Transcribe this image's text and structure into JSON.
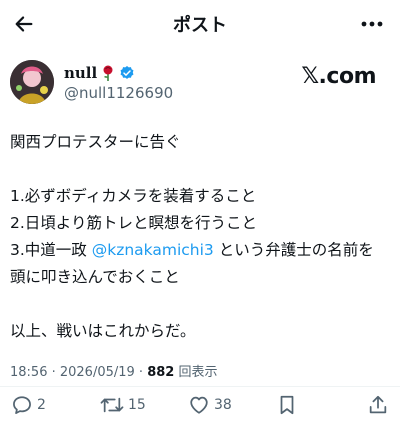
{
  "header": {
    "title": "ポスト"
  },
  "author": {
    "display_name": "null",
    "handle": "@null1126690",
    "verified": true
  },
  "watermark": "𝕏.com",
  "tweet": {
    "lines": [
      "関西プロテスターに告ぐ",
      "",
      "1.必ずボディカメラを装着すること",
      "2.日頃より筋トレと瞑想を行うこと",
      "3.中道一政 ",
      "頭に叩き込んでおくこと",
      "",
      "以上、戦いはこれからだ。"
    ],
    "mention": "@kznakamichi3",
    "line5_tail": " という弁護士の名前を"
  },
  "meta": {
    "time_date": "18:56 · 2026/05/19 · ",
    "views": "882",
    "views_label": " 回表示"
  },
  "actions": {
    "replies": "2",
    "reposts": "15",
    "likes": "38"
  },
  "colors": {
    "accent": "#1d9bf0",
    "text": "#0f1419",
    "muted": "#536471",
    "rose": "#c8102e"
  }
}
